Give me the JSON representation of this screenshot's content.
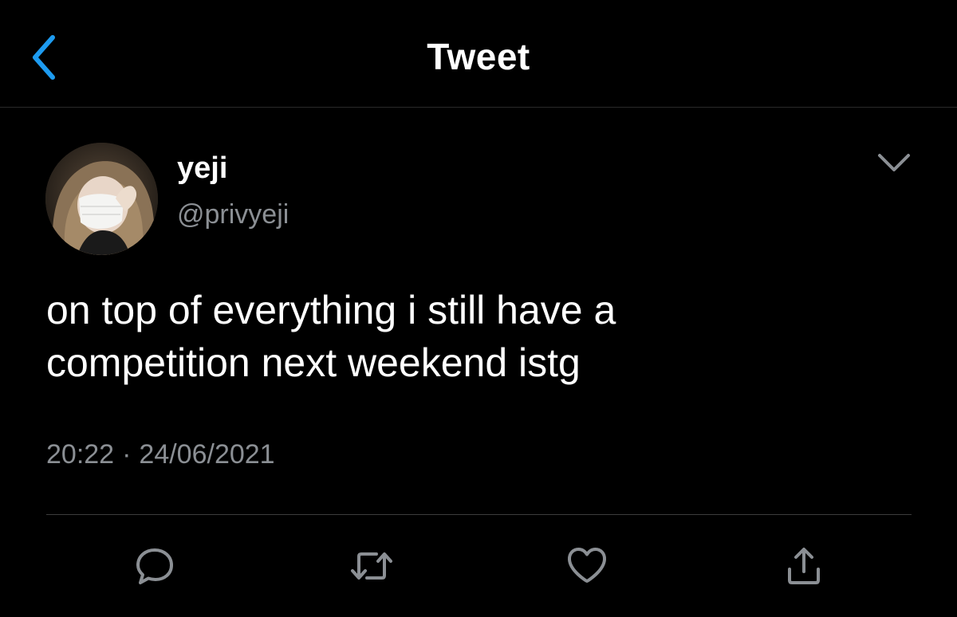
{
  "header": {
    "title": "Tweet",
    "back_icon": "chevron-left-icon",
    "accent_color": "#1d9bf0"
  },
  "tweet": {
    "author": {
      "display_name": "yeji",
      "handle": "@privyeji"
    },
    "text_lines": [
      "on top of everything i still have a",
      "competition next weekend istg"
    ],
    "time": "20:22",
    "separator": "·",
    "date": "24/06/2021",
    "more_icon": "chevron-down-icon"
  },
  "actions": [
    {
      "name": "reply",
      "icon": "reply-icon"
    },
    {
      "name": "retweet",
      "icon": "retweet-icon"
    },
    {
      "name": "like",
      "icon": "heart-icon"
    },
    {
      "name": "share",
      "icon": "share-icon"
    }
  ],
  "colors": {
    "background": "#000000",
    "text_primary": "#ffffff",
    "text_secondary": "#8b8f94",
    "icon_gray": "#8b8f94"
  }
}
